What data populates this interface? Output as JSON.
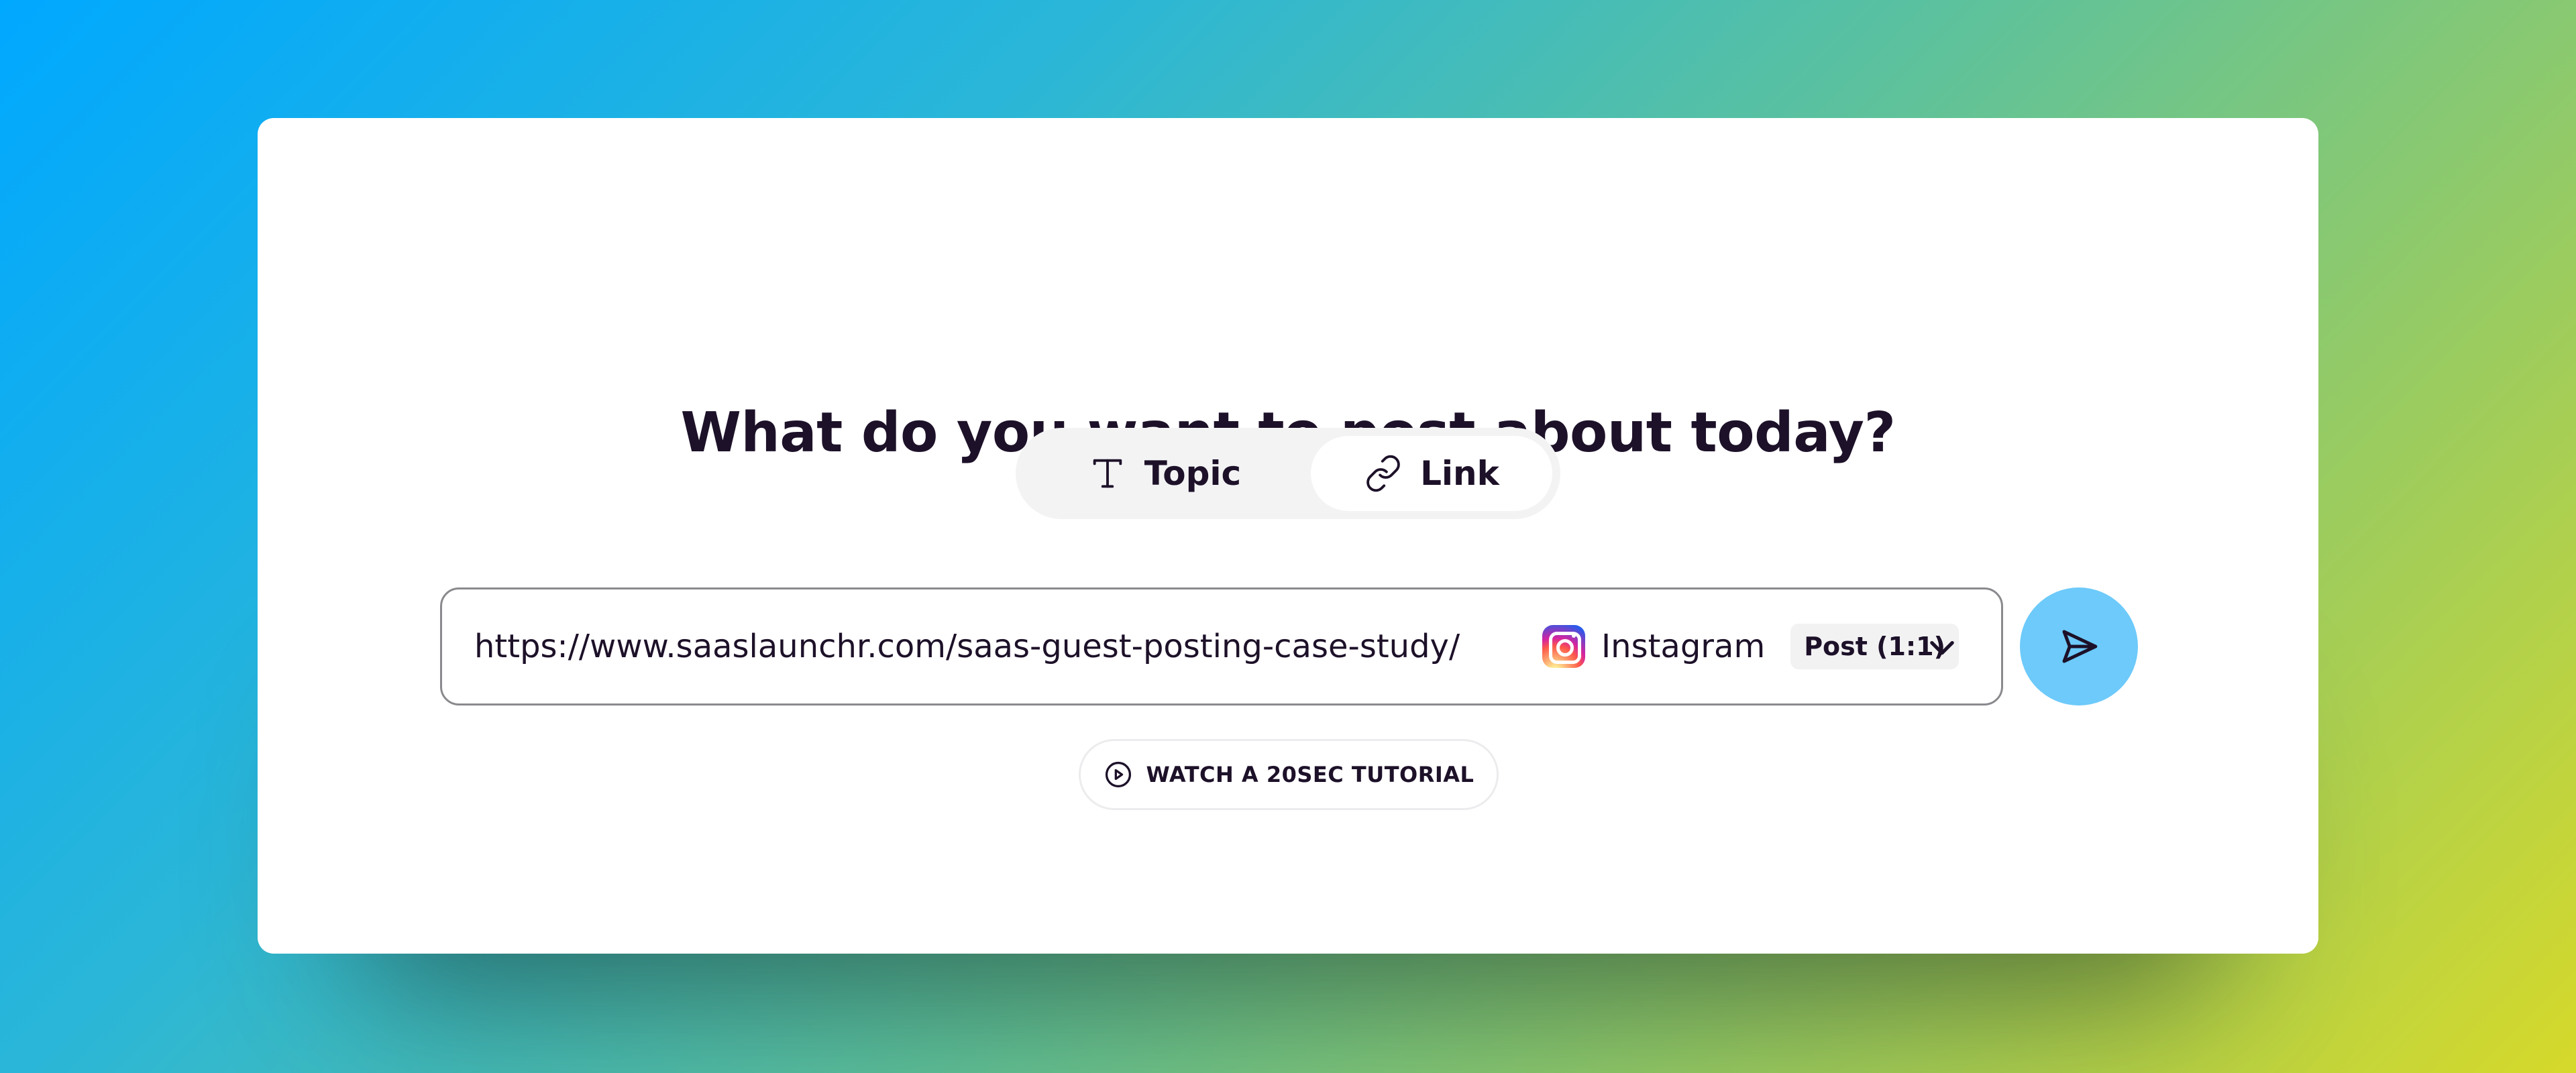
{
  "headline": "What do you want to post about today?",
  "mode_toggle": {
    "options": [
      {
        "label": "Topic",
        "icon": "text-icon",
        "selected": false
      },
      {
        "label": "Link",
        "icon": "link-icon",
        "selected": true
      }
    ]
  },
  "composer": {
    "url_value": "https://www.saaslaunchr.com/saas-guest-posting-case-study/",
    "platform": {
      "name": "Instagram",
      "icon": "instagram-icon",
      "format": "Post (1:1)"
    },
    "dropdown_icon": "chevron-down-icon",
    "send_icon": "send-icon"
  },
  "tutorial": {
    "label": "WATCH A 20SEC TUTORIAL",
    "icon": "play-circle-icon"
  },
  "colors": {
    "accent_send": "#6dcafa",
    "text_primary": "#1d1129",
    "toggle_bg": "#f3f3f4"
  }
}
